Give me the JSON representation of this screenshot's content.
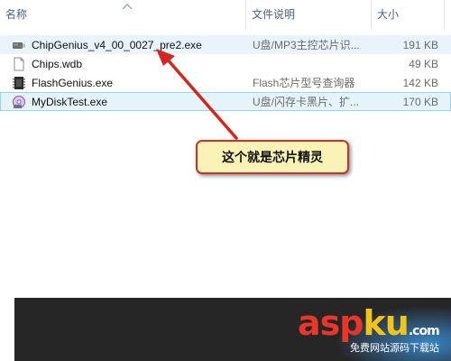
{
  "columns": {
    "name": "名称",
    "description": "文件说明",
    "size": "大小"
  },
  "files": [
    {
      "name": "ChipGenius_v4_00_0027_pre2.exe",
      "description": "U盘/MP3主控芯片识...",
      "size": "191 KB",
      "icon": "usb-drive-icon",
      "state": "hover"
    },
    {
      "name": "Chips.wdb",
      "description": "",
      "size": "49 KB",
      "icon": "document-icon",
      "state": "normal"
    },
    {
      "name": "FlashGenius.exe",
      "description": "Flash芯片型号查询器",
      "size": "142 KB",
      "icon": "chip-icon",
      "state": "normal"
    },
    {
      "name": "MyDiskTest.exe",
      "description": "U盘/闪存卡黑片、扩...",
      "size": "170 KB",
      "icon": "disk-test-icon",
      "state": "selected"
    }
  ],
  "annotation": {
    "text": "这个就是芯片精灵",
    "border_color": "#c9302c",
    "fill_color": "#fbf3b6"
  },
  "watermark": {
    "letters": [
      "a",
      "s",
      "p",
      "k",
      "u"
    ],
    "letter_colors": [
      "#e8362b",
      "#e8362b",
      "#e8362b",
      "#f0c419",
      "#f0c419"
    ],
    "suffix": ".com",
    "subtitle": "免费网站源码下载站"
  },
  "colors": {
    "selected_bg": "#e5f3fb",
    "selected_border": "#99d1f2",
    "header_text": "#4c607a"
  }
}
